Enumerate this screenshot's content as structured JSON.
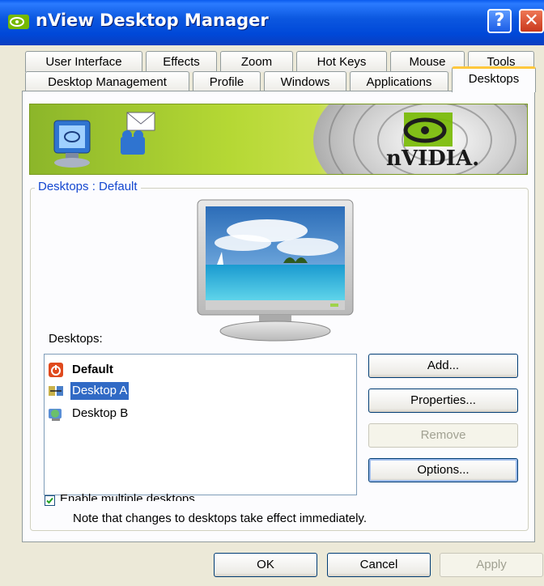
{
  "window": {
    "title": "nView Desktop Manager"
  },
  "title_buttons": {
    "help": "?",
    "close": "✕"
  },
  "tabs_top": [
    "User Interface",
    "Effects",
    "Zoom",
    "Hot Keys",
    "Mouse",
    "Tools"
  ],
  "tabs_bottom": [
    "Desktop Management",
    "Profile",
    "Windows",
    "Applications",
    "Desktops"
  ],
  "active_tab": "Desktops",
  "banner": {
    "brand": "nVIDIA."
  },
  "group": {
    "legend": "Desktops : Default"
  },
  "list": {
    "label": "Desktops:",
    "items": [
      {
        "label": "Default",
        "bold": true,
        "selected": false,
        "icon": "power-icon"
      },
      {
        "label": "Desktop A",
        "bold": false,
        "selected": true,
        "icon": "desktop-a-icon"
      },
      {
        "label": "Desktop B",
        "bold": false,
        "selected": false,
        "icon": "globe-monitor-icon"
      }
    ]
  },
  "buttons": {
    "add": "Add...",
    "properties": "Properties...",
    "remove": "Remove",
    "options": "Options..."
  },
  "checkbox": {
    "label": "Enable multiple desktops",
    "checked": true
  },
  "note": "Note that changes to desktops take effect immediately.",
  "footer": {
    "ok": "OK",
    "cancel": "Cancel",
    "apply": "Apply"
  },
  "colors": {
    "title_blue": "#0054E3",
    "selection": "#316AC5",
    "tab_highlight": "#FFC83C",
    "legend": "#1447D0"
  }
}
